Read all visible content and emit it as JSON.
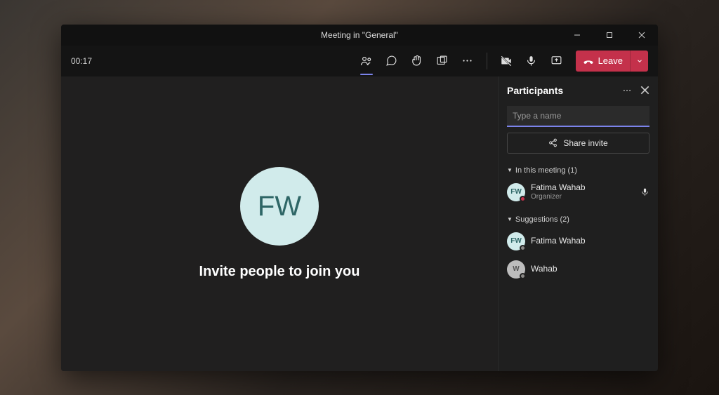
{
  "titlebar": {
    "title": "Meeting in \"General\""
  },
  "toolbar": {
    "timer": "00:17",
    "leave_label": "Leave"
  },
  "stage": {
    "avatar_initials": "FW",
    "invite_text": "Invite people to join you"
  },
  "panel": {
    "title": "Participants",
    "search_placeholder": "Type a name",
    "share_label": "Share invite",
    "sections": {
      "in_meeting": {
        "label": "In this meeting (1)",
        "items": [
          {
            "initials": "FW",
            "name": "Fatima Wahab",
            "role": "Organizer",
            "avatar": "teal",
            "presence": "busy",
            "mic": true
          }
        ]
      },
      "suggestions": {
        "label": "Suggestions (2)",
        "items": [
          {
            "initials": "FW",
            "name": "Fatima Wahab",
            "avatar": "teal",
            "presence": "offline"
          },
          {
            "initials": "W",
            "name": "Wahab",
            "avatar": "grey",
            "presence": "offline"
          }
        ]
      }
    }
  }
}
